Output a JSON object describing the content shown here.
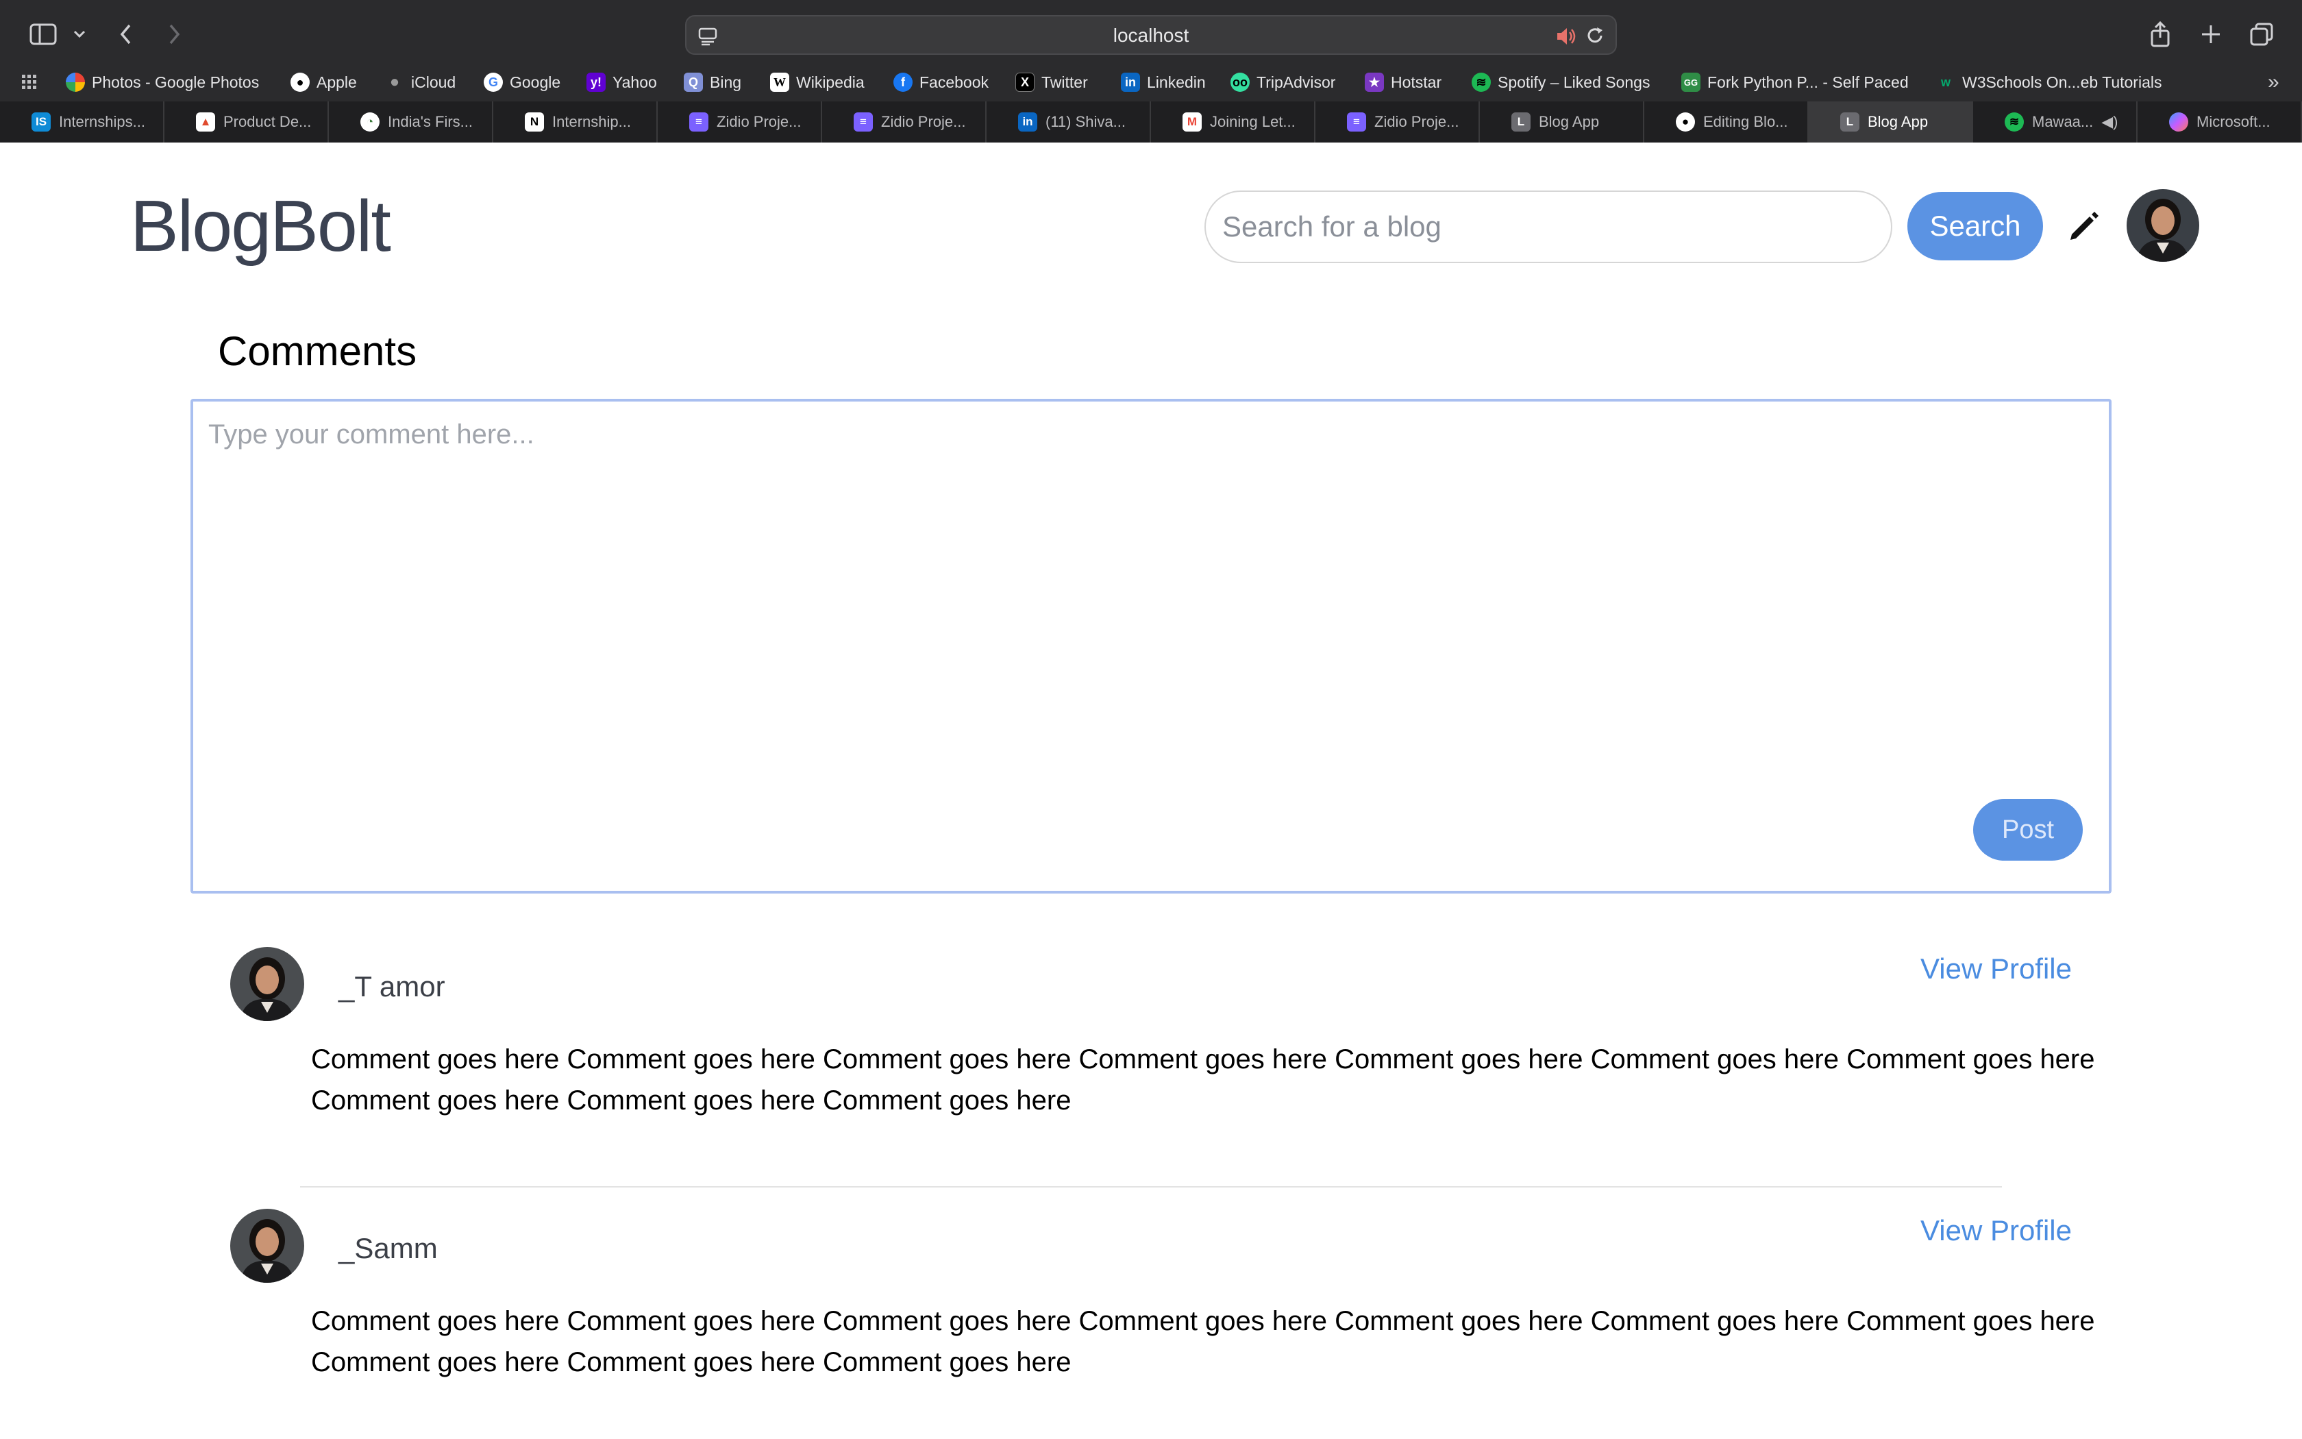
{
  "browser": {
    "url": "localhost",
    "favorites": [
      {
        "label": "Photos - Google Photos",
        "icon": "google-photos-icon",
        "color": "#e8453c"
      },
      {
        "label": "Apple",
        "icon": "apple-icon",
        "color": "#ffffff"
      },
      {
        "label": "iCloud",
        "icon": "apple-icon",
        "color": "#9a9a9a"
      },
      {
        "label": "Google",
        "icon": "google-icon",
        "color": "#4285f4"
      },
      {
        "label": "Yahoo",
        "icon": "yahoo-icon",
        "color": "#6001d2"
      },
      {
        "label": "Bing",
        "icon": "bing-icon",
        "color": "#6b7bd0"
      },
      {
        "label": "Wikipedia",
        "icon": "wikipedia-icon",
        "color": "#ffffff"
      },
      {
        "label": "Facebook",
        "icon": "facebook-icon",
        "color": "#1877f2"
      },
      {
        "label": "Twitter",
        "icon": "x-icon",
        "color": "#000000"
      },
      {
        "label": "Linkedin",
        "icon": "linkedin-icon",
        "color": "#0a66c2"
      },
      {
        "label": "TripAdvisor",
        "icon": "tripadvisor-icon",
        "color": "#34e0a1"
      },
      {
        "label": "Hotstar",
        "icon": "hotstar-icon",
        "color": "#7a38c2"
      },
      {
        "label": "Spotify – Liked Songs",
        "icon": "spotify-icon",
        "color": "#1db954"
      },
      {
        "label": "Fork Python P... - Self Paced",
        "icon": "gfg-icon",
        "color": "#2f8d46"
      },
      {
        "label": "W3Schools On...eb Tutorials",
        "icon": "w3schools-icon",
        "color": "#04aa6d"
      }
    ],
    "tabs": [
      {
        "label": "Internships...",
        "icon": "internshala-icon",
        "color": "#0f8bd6"
      },
      {
        "label": "Product De...",
        "icon": "product-icon",
        "color": "#e04a2e"
      },
      {
        "label": "India's Firs...",
        "icon": "site-icon",
        "color": "#3b7a3b"
      },
      {
        "label": "Internship...",
        "icon": "notion-icon",
        "color": "#ffffff"
      },
      {
        "label": "Zidio Proje...",
        "icon": "list-icon",
        "color": "#7b61ff"
      },
      {
        "label": "Zidio Proje...",
        "icon": "list-icon",
        "color": "#7b61ff"
      },
      {
        "label": "(11) Shiva...",
        "icon": "linkedin-icon",
        "color": "#0a66c2"
      },
      {
        "label": "Joining Let...",
        "icon": "gmail-icon",
        "color": "#ea4335"
      },
      {
        "label": "Zidio Proje...",
        "icon": "list-icon",
        "color": "#7b61ff"
      },
      {
        "label": "Blog App",
        "icon": "letter-l-icon",
        "color": "#6b6b70"
      },
      {
        "label": "Editing Blo...",
        "icon": "github-icon",
        "color": "#ffffff"
      },
      {
        "label": "Blog App",
        "icon": "letter-l-icon",
        "color": "#6b6b70",
        "active": true
      },
      {
        "label": "Mawaa...",
        "icon": "spotify-icon",
        "color": "#1db954"
      },
      {
        "label": "Microsoft...",
        "icon": "copilot-icon",
        "color": "#c65cff"
      }
    ]
  },
  "app": {
    "brand": "BlogBolt",
    "search": {
      "placeholder": "Search for a blog",
      "button_label": "Search"
    }
  },
  "comments": {
    "title": "Comments",
    "input_placeholder": "Type your comment here...",
    "post_label": "Post",
    "view_profile_label": "View Profile",
    "items": [
      {
        "author": "_T amor",
        "text": "Comment goes here Comment goes here Comment goes here Comment goes here Comment goes here Comment goes here Comment goes here Comment goes here Comment goes here Comment goes here"
      },
      {
        "author": "_Samm",
        "text": "Comment goes here Comment goes here Comment goes here Comment goes here Comment goes here Comment goes here Comment goes here Comment goes here Comment goes here Comment goes here"
      }
    ]
  },
  "colors": {
    "accent": "#5b93e3",
    "link": "#4a8ce0",
    "brand": "#3b4252"
  }
}
